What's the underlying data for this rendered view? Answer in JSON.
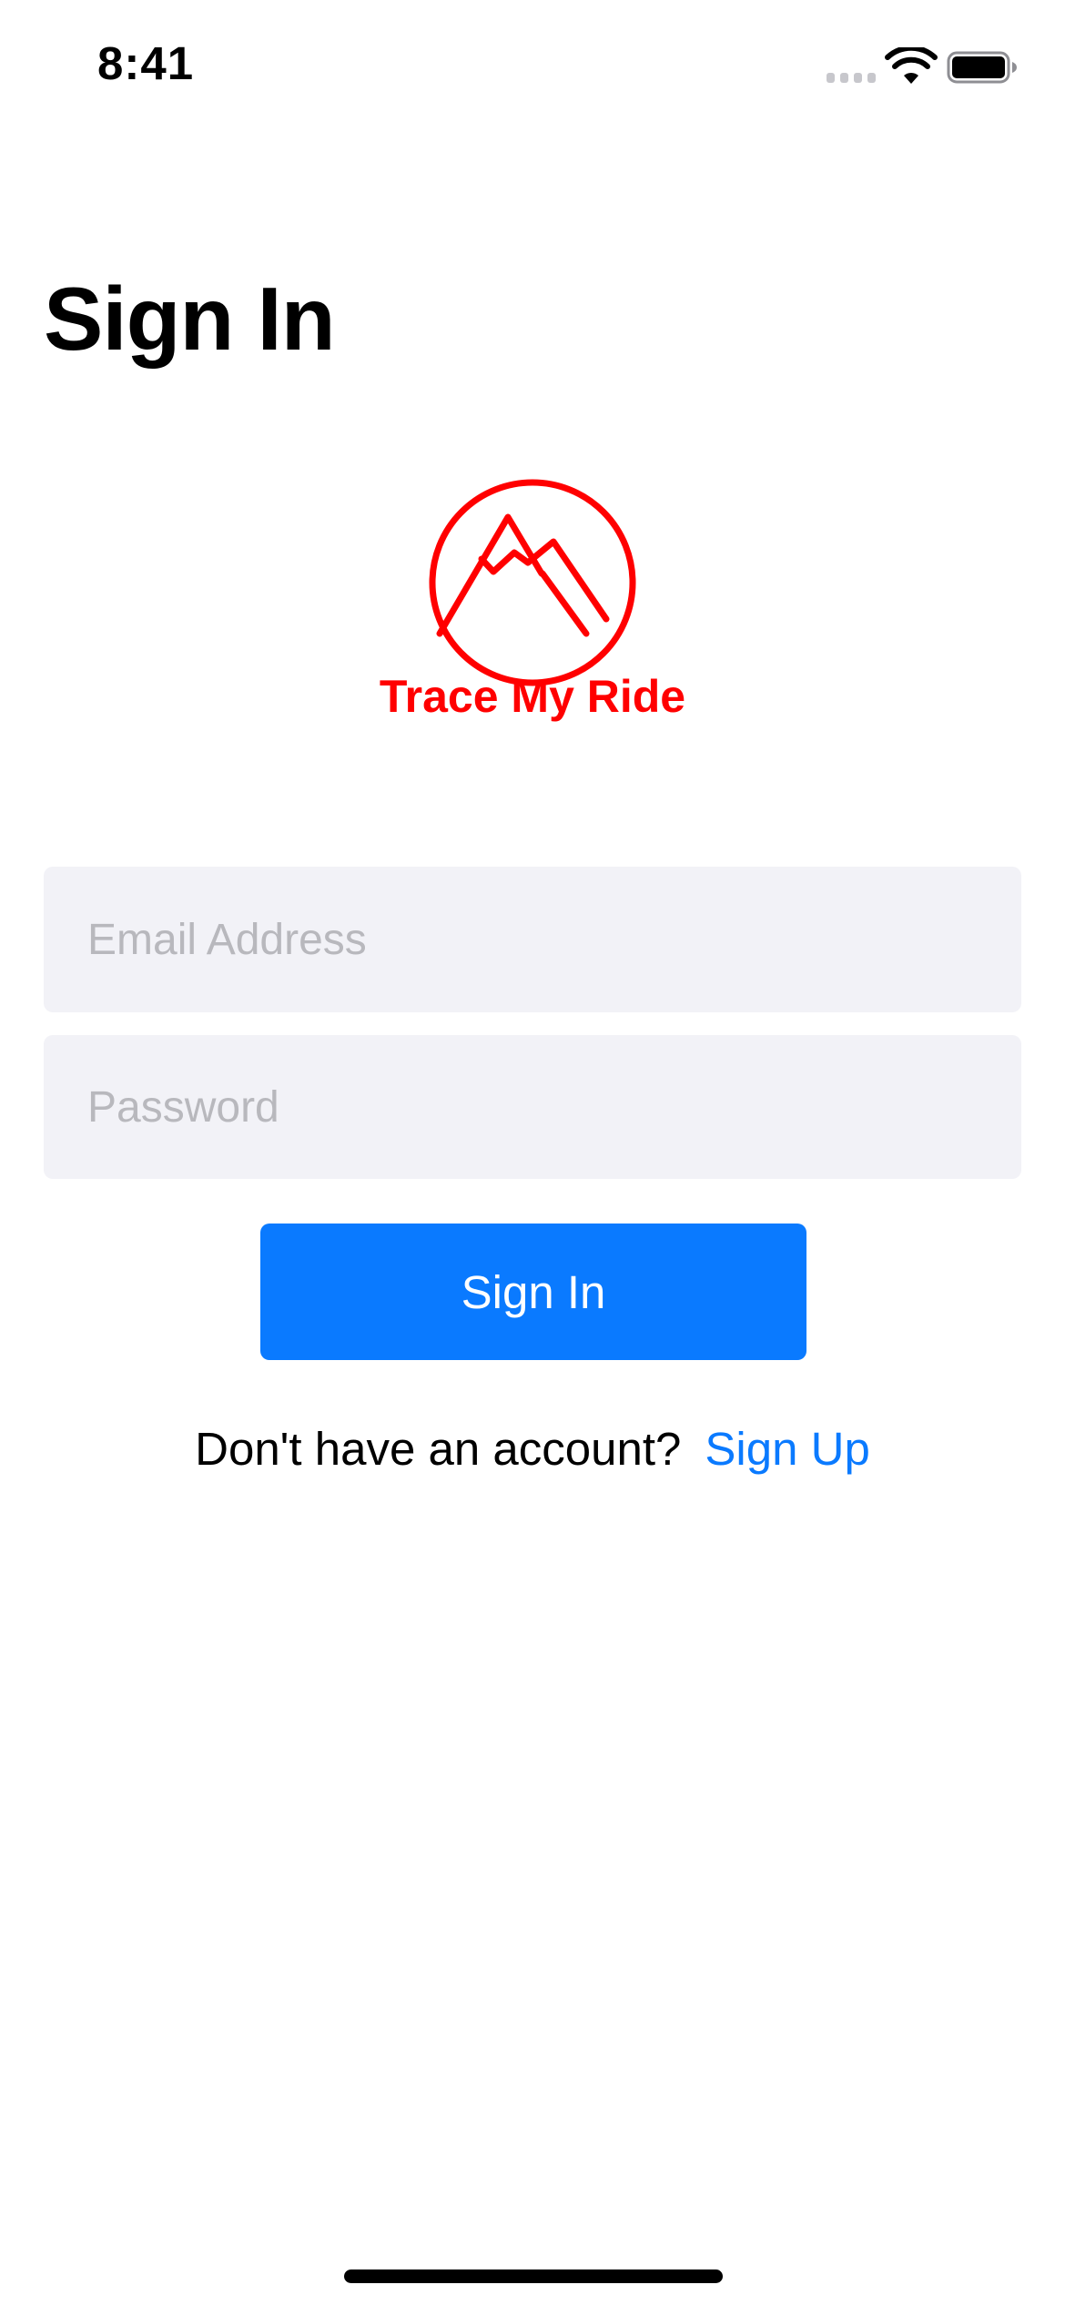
{
  "status_bar": {
    "time": "8:41",
    "signal_icon": "cellular-signal-icon",
    "wifi_icon": "wifi-icon",
    "battery_icon": "battery-icon"
  },
  "page": {
    "title": "Sign In"
  },
  "logo": {
    "text": "Trace My Ride",
    "icon": "mountain-logo-icon",
    "color": "#ff0000"
  },
  "form": {
    "email_placeholder": "Email Address",
    "email_value": "",
    "password_placeholder": "Password",
    "password_value": "",
    "signin_label": "Sign In"
  },
  "signup": {
    "prompt": "Don't have an account?",
    "link_label": "Sign Up"
  },
  "colors": {
    "accent": "#0a7aff",
    "field_background": "#f2f2f7",
    "placeholder": "#b8b8bd",
    "logo_red": "#ff0000"
  }
}
